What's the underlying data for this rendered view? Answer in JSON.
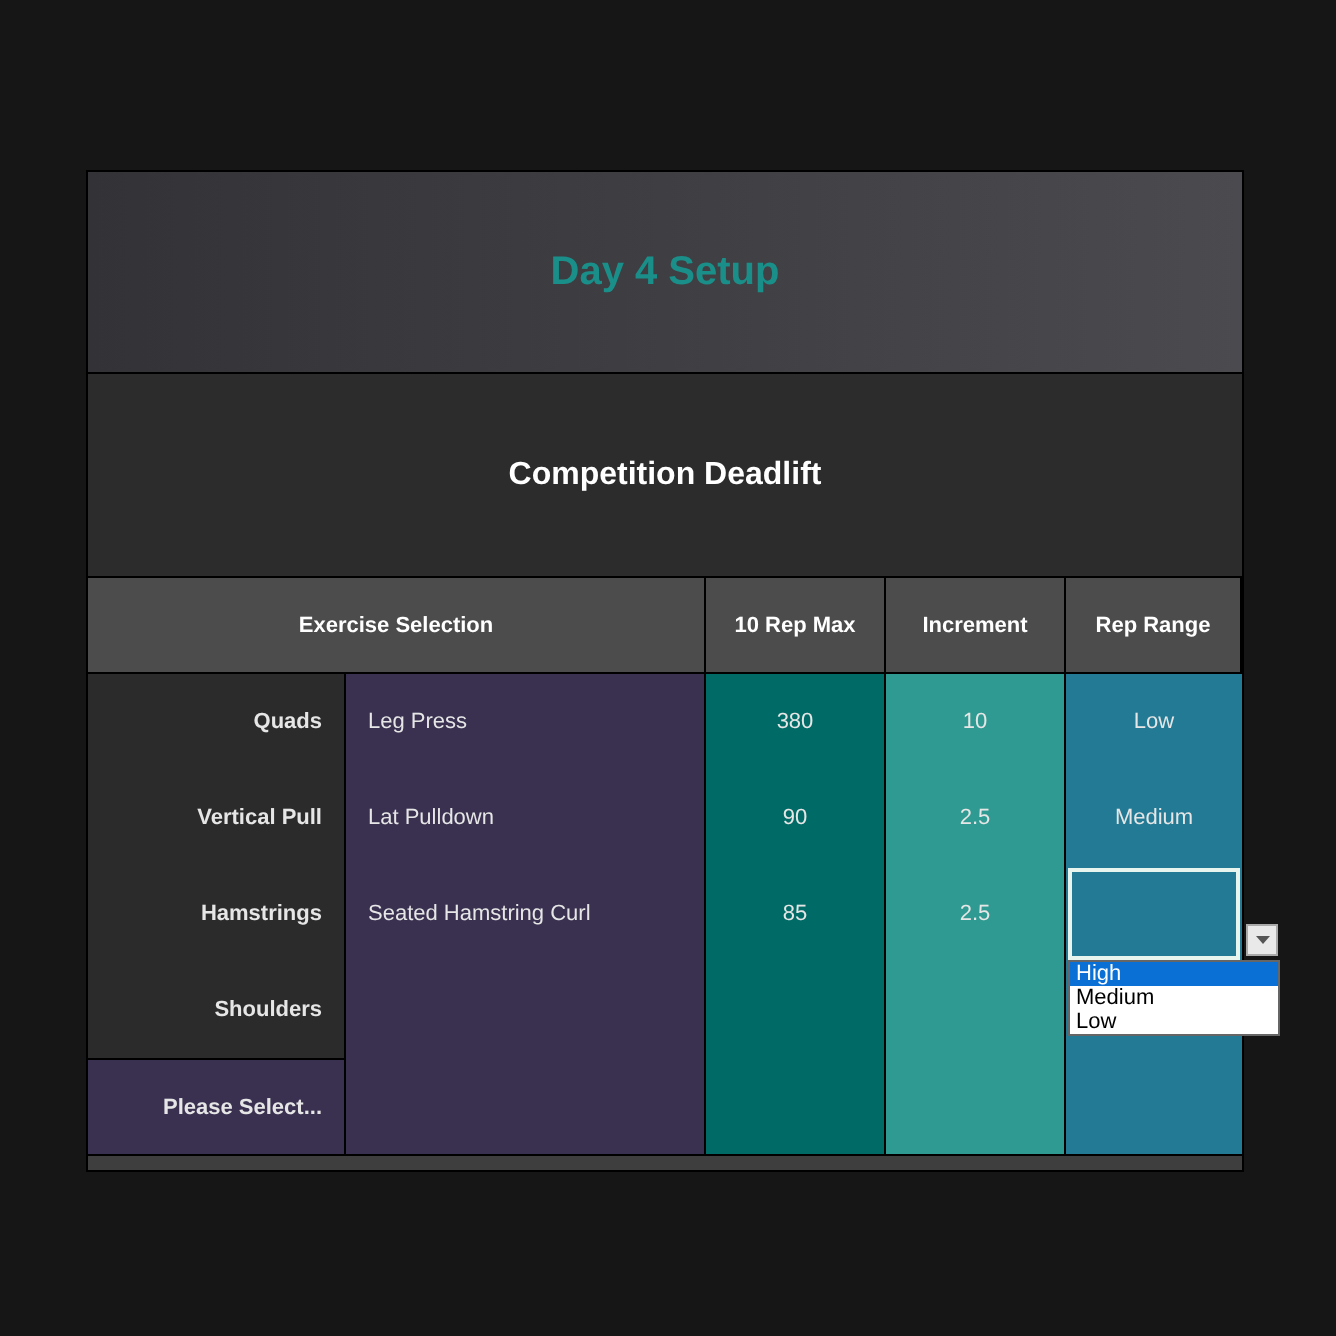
{
  "title": "Day 4 Setup",
  "subtitle": "Competition Deadlift",
  "columns": [
    "Exercise Selection",
    "10 Rep Max",
    "Increment",
    "Rep Range"
  ],
  "rows": [
    {
      "kind": "muscle",
      "muscle": "Quads",
      "exercise": "Leg Press",
      "rep_max": "380",
      "increment": "10",
      "rep_range": "Low",
      "active": false
    },
    {
      "kind": "muscle",
      "muscle": "Vertical Pull",
      "exercise": "Lat Pulldown",
      "rep_max": "90",
      "increment": "2.5",
      "rep_range": "Medium",
      "active": false
    },
    {
      "kind": "muscle",
      "muscle": "Hamstrings",
      "exercise": "Seated Hamstring Curl",
      "rep_max": "85",
      "increment": "2.5",
      "active": true
    },
    {
      "kind": "muscle",
      "muscle": "Shoulders",
      "active": false
    },
    {
      "kind": "placeholder",
      "muscle": "Please Select...",
      "active": false
    }
  ],
  "dropdown": {
    "options": [
      {
        "label": "High",
        "selected": true
      },
      {
        "label": "Medium",
        "selected": false
      },
      {
        "label": "Low",
        "selected": false
      }
    ]
  }
}
